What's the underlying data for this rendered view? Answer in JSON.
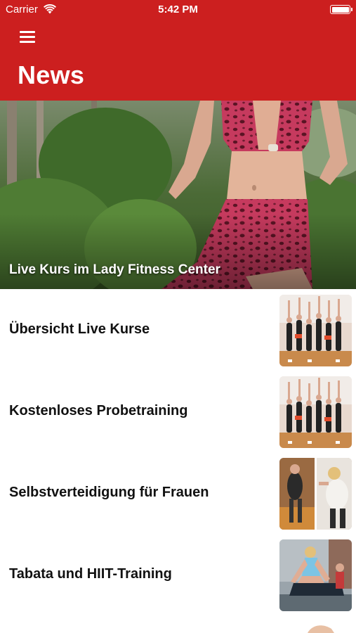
{
  "status_bar": {
    "carrier": "Carrier",
    "time": "5:42 PM",
    "wifi_icon": "wifi-icon",
    "battery_icon": "battery-full-icon"
  },
  "nav": {
    "menu_icon": "hamburger-menu-icon",
    "title": "News",
    "background_color": "#cc1f1f"
  },
  "featured": {
    "caption": "Live Kurs im Lady Fitness Center",
    "image": "yoga-prayer-pose-photo"
  },
  "items": [
    {
      "title": "Übersicht Live Kurse",
      "thumbnail": "group-dance-class-photo"
    },
    {
      "title": "Kostenloses Probetraining",
      "thumbnail": "group-dance-class-photo"
    },
    {
      "title": "Selbstverteidigung für Frauen",
      "thumbnail": "self-defense-training-photo"
    },
    {
      "title": "Tabata und HIIT-Training",
      "thumbnail": "stretching-woman-photo"
    }
  ]
}
